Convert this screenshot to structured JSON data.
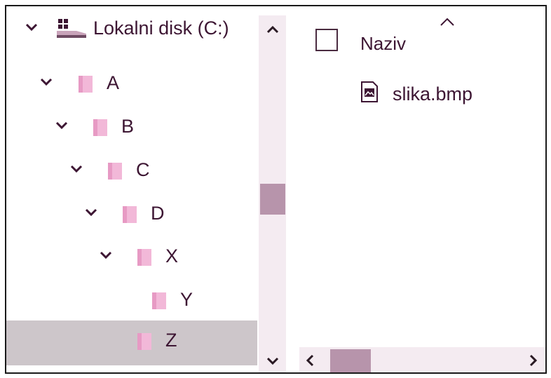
{
  "tree": {
    "items": [
      {
        "label": "Lokalni disk (C:)",
        "icon": "drive-icon",
        "expanded": true,
        "selected": false
      },
      {
        "label": "A",
        "icon": "folder-icon",
        "expanded": true,
        "selected": false
      },
      {
        "label": "B",
        "icon": "folder-icon",
        "expanded": true,
        "selected": false
      },
      {
        "label": "C",
        "icon": "folder-icon",
        "expanded": true,
        "selected": false
      },
      {
        "label": "D",
        "icon": "folder-icon",
        "expanded": true,
        "selected": false
      },
      {
        "label": "X",
        "icon": "folder-icon",
        "expanded": true,
        "selected": false
      },
      {
        "label": "Y",
        "icon": "folder-icon",
        "expanded": false,
        "selected": false
      },
      {
        "label": "Z",
        "icon": "folder-icon",
        "expanded": false,
        "selected": true
      }
    ]
  },
  "vertical_scrollbar": {
    "up_icon": "chevron-up-icon",
    "down_icon": "chevron-down-icon",
    "position_fraction": 0.55
  },
  "file_list": {
    "header": {
      "label": "Naziv",
      "sort_icon": "sort-ascending-icon"
    },
    "files": [
      {
        "name": "slika.bmp",
        "icon": "image-file-icon"
      }
    ]
  },
  "horizontal_scrollbar": {
    "left_icon": "chevron-left-icon",
    "right_icon": "chevron-right-icon",
    "position_fraction": 0.0
  },
  "colors": {
    "accent": "#b794ab",
    "selection": "#cdc6ca",
    "scroll_track": "#f4ebf1",
    "text": "#3d1633",
    "folder": "#f2b8d8"
  }
}
